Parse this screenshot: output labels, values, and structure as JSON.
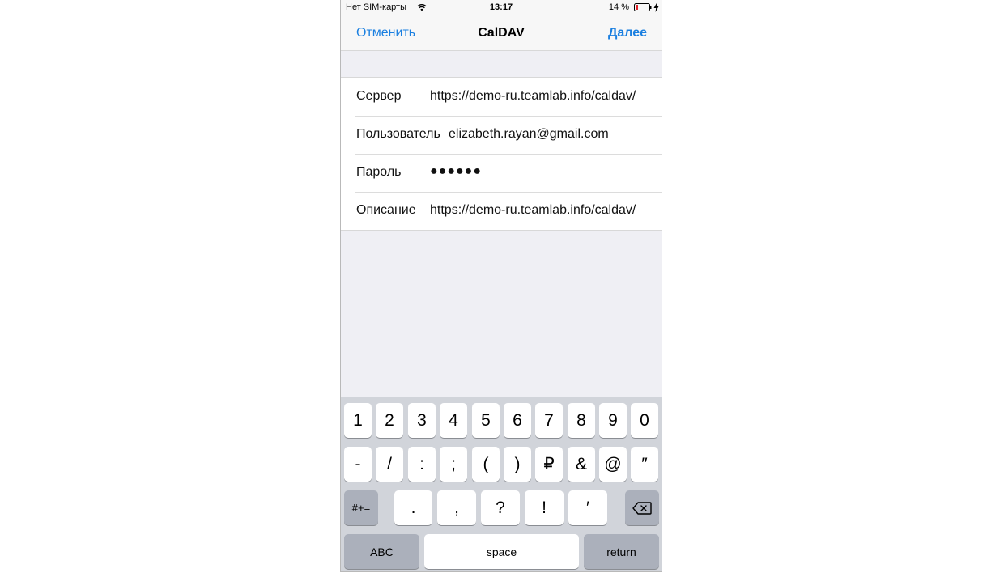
{
  "status_bar": {
    "carrier": "Нет SIM-карты",
    "time": "13:17",
    "battery": "14 %"
  },
  "nav": {
    "cancel": "Отменить",
    "title": "CalDAV",
    "next": "Далее"
  },
  "form": {
    "rows": [
      {
        "label": "Сервер",
        "value": "https://demo-ru.teamlab.info/caldav/"
      },
      {
        "label": "Пользователь",
        "value": "elizabeth.rayan@gmail.com"
      },
      {
        "label": "Пароль",
        "value": "●●●●●●"
      },
      {
        "label": "Описание",
        "value": "https://demo-ru.teamlab.info/caldav/"
      }
    ]
  },
  "keyboard": {
    "row1": [
      "1",
      "2",
      "3",
      "4",
      "5",
      "6",
      "7",
      "8",
      "9",
      "0"
    ],
    "row2": [
      "-",
      "/",
      ":",
      ";",
      "(",
      ")",
      "₽",
      "&",
      "@",
      "″"
    ],
    "row3": [
      ".",
      ",",
      "?",
      "!",
      "′"
    ],
    "symbols_key": "#+=",
    "abc_key": "ABC",
    "space_key": "space",
    "return_key": "return"
  },
  "colors": {
    "accent": "#1a7fe0",
    "background": "#efeff4",
    "keyboard_bg": "#d1d4da",
    "function_key": "#abb0bb"
  }
}
